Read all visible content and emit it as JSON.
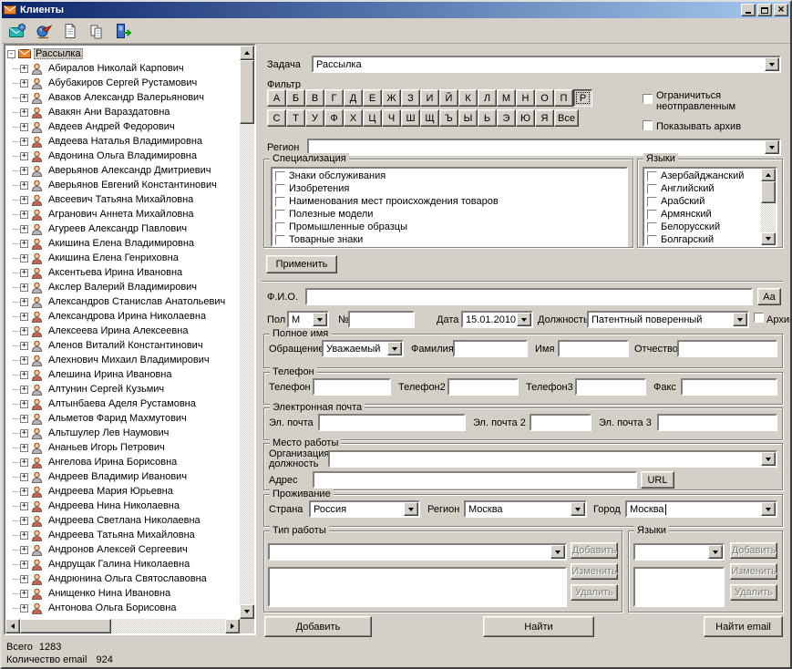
{
  "window": {
    "title": "Клиенты"
  },
  "toolbar": {
    "icons": [
      "envelope-globe-icon",
      "bird-icon",
      "document-icon",
      "documents-icon",
      "exit-door-icon"
    ]
  },
  "tree": {
    "root": {
      "label": "Рассылка"
    },
    "items": [
      {
        "name": "Абиралов Николай Карпович",
        "icon": "person-gray"
      },
      {
        "name": "Абубакиров Сергей Рустамович",
        "icon": "person-gray"
      },
      {
        "name": "Аваков Александр Валерьянович",
        "icon": "person-gray"
      },
      {
        "name": "Авакян Ани Вараздатовна",
        "icon": "person-red"
      },
      {
        "name": "Авдеев Андрей Федорович",
        "icon": "person-gray"
      },
      {
        "name": "Авдеева Наталья Владимировна",
        "icon": "person-red"
      },
      {
        "name": "Авдонина Ольга Владимировна",
        "icon": "person-red"
      },
      {
        "name": "Аверьянов Александр Дмитриевич",
        "icon": "person-gray"
      },
      {
        "name": "Аверьянов Евгений Константинович",
        "icon": "person-gray"
      },
      {
        "name": "Авсеевич Татьяна Михайловна",
        "icon": "person-red"
      },
      {
        "name": "Агранович Аннета Михайловна",
        "icon": "person-red"
      },
      {
        "name": "Агуреев Александр Павлович",
        "icon": "person-gray"
      },
      {
        "name": "Акишина Елена Владимировна",
        "icon": "person-red"
      },
      {
        "name": "Акишина Елена Генриховна",
        "icon": "person-red"
      },
      {
        "name": "Аксентьева Ирина Ивановна",
        "icon": "person-red"
      },
      {
        "name": "Акслер Валерий Владимирович",
        "icon": "person-gray"
      },
      {
        "name": "Александров Станислав Анатольевич",
        "icon": "person-gray"
      },
      {
        "name": "Александрова Ирина Николаевна",
        "icon": "person-red"
      },
      {
        "name": "Алексеева Ирина Алексеевна",
        "icon": "person-red"
      },
      {
        "name": "Аленов Виталий Константинович",
        "icon": "person-gray"
      },
      {
        "name": "Алехнович Михаил Владимирович",
        "icon": "person-gray"
      },
      {
        "name": "Алешина Ирина Ивановна",
        "icon": "person-red"
      },
      {
        "name": "Алтунин Сергей Кузьмич",
        "icon": "person-gray"
      },
      {
        "name": "Алтынбаева Аделя Рустамовна",
        "icon": "person-red"
      },
      {
        "name": "Альметов Фарид Махмутович",
        "icon": "person-gray"
      },
      {
        "name": "Альтшулер Лев Наумович",
        "icon": "person-gray"
      },
      {
        "name": "Ананьев Игорь Петрович",
        "icon": "person-gray"
      },
      {
        "name": "Ангелова Ирина Борисовна",
        "icon": "person-red"
      },
      {
        "name": "Андреев Владимир Иванович",
        "icon": "person-gray"
      },
      {
        "name": "Андреева Мария Юрьевна",
        "icon": "person-red"
      },
      {
        "name": "Андреева Нина Николаевна",
        "icon": "person-red"
      },
      {
        "name": "Андреева Светлана Николаевна",
        "icon": "person-red"
      },
      {
        "name": "Андреева Татьяна Михайловна",
        "icon": "person-red"
      },
      {
        "name": "Андронов Алексей Сергеевич",
        "icon": "person-gray"
      },
      {
        "name": "Андрущак Галина Николаевна",
        "icon": "person-red"
      },
      {
        "name": "Андрюнина Ольга Святославовна",
        "icon": "person-red"
      },
      {
        "name": "Анищенко Нина Ивановна",
        "icon": "person-red"
      },
      {
        "name": "Антонова Ольга Борисовна",
        "icon": "person-red"
      }
    ]
  },
  "status": {
    "total_label": "Всего",
    "total_value": "1283",
    "email_label": "Количество email",
    "email_value": "924"
  },
  "form": {
    "task": {
      "label": "Задача",
      "value": "Рассылка"
    },
    "filter": {
      "label": "Фильтр",
      "letters_row1": [
        "А",
        "Б",
        "В",
        "Г",
        "Д",
        "Е",
        "Ж",
        "З",
        "И",
        "Й",
        "К",
        "Л",
        "М",
        "Н",
        "О",
        "П",
        "Р"
      ],
      "letters_row2": [
        "С",
        "Т",
        "У",
        "Ф",
        "Х",
        "Ц",
        "Ч",
        "Ш",
        "Щ",
        "Ъ",
        "Ы",
        "Ь",
        "Э",
        "Ю",
        "Я",
        "Все"
      ],
      "pressed_letter": "Р",
      "limit_unsent_label": "Ограничиться неотправленным",
      "show_archive_label": "Показывать архив"
    },
    "region_filter": {
      "label": "Регион",
      "value": ""
    },
    "specialization": {
      "title": "Специализация",
      "items": [
        "Знаки обслуживания",
        "Изобретения",
        "Наименования мест происхождения товаров",
        "Полезные модели",
        "Промышленные образцы",
        "Товарные знаки"
      ]
    },
    "languages_filter": {
      "title": "Языки",
      "items": [
        "Азербайджанский",
        "Английский",
        "Арабский",
        "Армянский",
        "Белорусский",
        "Болгарский"
      ]
    },
    "apply_label": "Применить",
    "fio": {
      "label": "Ф.И.О.",
      "value": "",
      "case_button": "Аа"
    },
    "details": {
      "gender_label": "Пол",
      "gender_value": "М",
      "number_label": "№",
      "number_value": "",
      "date_label": "Дата",
      "date_value": "15.01.2010",
      "position_label": "Должность",
      "position_value": "Патентный поверенный",
      "archive_label": "Архив"
    },
    "full_name": {
      "title": "Полное имя",
      "salutation_label": "Обращение",
      "salutation_value": "Уважаемый",
      "surname_label": "Фамилия",
      "name_label": "Имя",
      "patronymic_label": "Отчество"
    },
    "phones": {
      "title": "Телефон",
      "labels": [
        "Телефон",
        "Телефон2",
        "Телефон3",
        "Факс"
      ]
    },
    "emails": {
      "title": "Электронная почта",
      "labels": [
        "Эл. почта",
        "Эл. почта 2",
        "Эл. почта 3"
      ]
    },
    "work": {
      "title": "Место работы",
      "org_label_line1": "Организация,",
      "org_label_line2": "должность",
      "address_label": "Адрес",
      "url_label": "URL"
    },
    "residence": {
      "title": "Проживание",
      "country_label": "Страна",
      "country_value": "Россия",
      "region_label": "Регион",
      "region_value": "Москва",
      "city_label": "Город",
      "city_value": "Москва"
    },
    "work_type": {
      "title": "Тип работы",
      "add_label": "Добавить",
      "edit_label": "Изменить",
      "delete_label": "Удалить"
    },
    "languages_edit": {
      "title": "Языки",
      "add_label": "Добавить",
      "edit_label": "Изменить",
      "delete_label": "Удалить"
    },
    "actions": {
      "add": "Добавить",
      "find": "Найти",
      "find_email": "Найти email"
    }
  }
}
